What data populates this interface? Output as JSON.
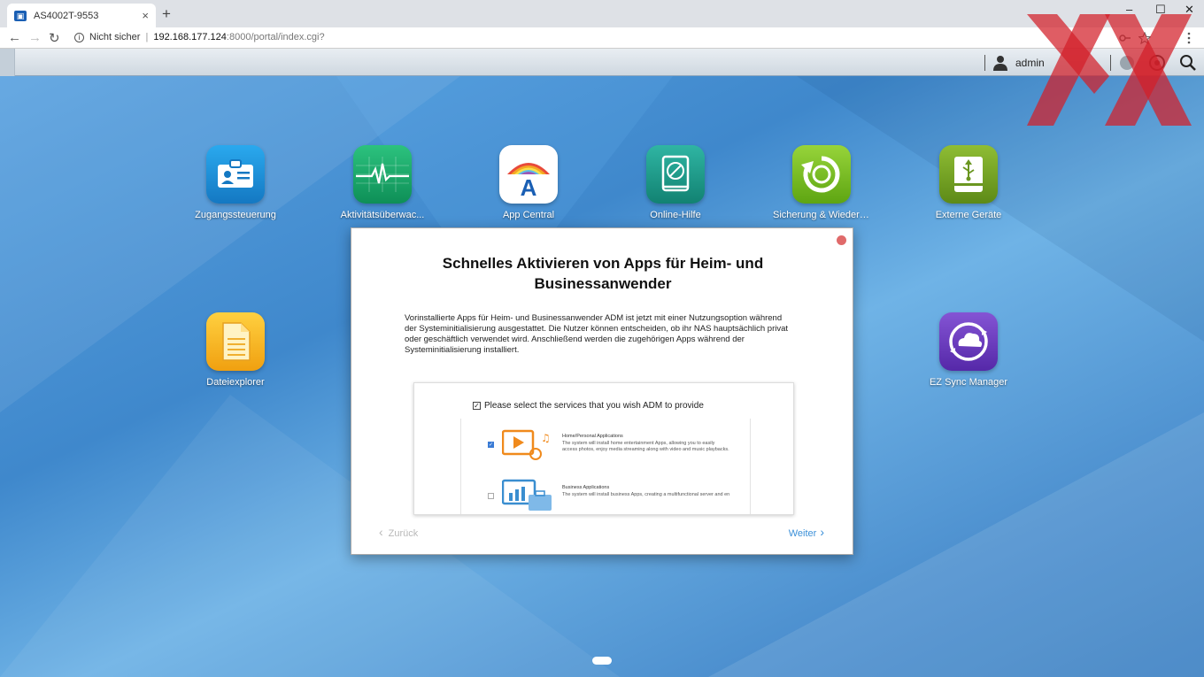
{
  "browser": {
    "tab_title": "AS4002T-9553",
    "tab_close": "×",
    "new_tab": "+",
    "security": "Nicht sicher",
    "url_host": "192.168.177.124",
    "url_path": ":8000/portal/index.cgi?",
    "win_min": "–",
    "win_max": "☐",
    "win_close": "✕",
    "back": "←",
    "forward": "→",
    "reload": "↻"
  },
  "taskbar": {
    "user": "admin"
  },
  "apps": [
    {
      "label": "Zugangssteuerung",
      "icon": "access-control-icon",
      "color": "#1b8fd6"
    },
    {
      "label": "Aktivitätsüberwac...",
      "icon": "activity-monitor-icon",
      "color": "#1aa56a"
    },
    {
      "label": "App Central",
      "icon": "app-central-icon",
      "color": "#ffffff"
    },
    {
      "label": "Online-Hilfe",
      "icon": "online-help-icon",
      "color": "#1f9c8c"
    },
    {
      "label": "Sicherung & Wiederherstellung",
      "icon": "backup-icon",
      "color": "#7cc21e"
    },
    {
      "label": "Externe Geräte",
      "icon": "external-devices-icon",
      "color": "#7ea62a"
    },
    {
      "label": "Dateiexplorer",
      "icon": "file-explorer-icon",
      "color": "#f2a81c"
    },
    {
      "label": "EZ Sync Manager",
      "icon": "ez-sync-icon",
      "color": "#6a3fb8"
    }
  ],
  "modal": {
    "title": "Schnelles Aktivieren von Apps für Heim- und Businessanwender",
    "body": "Vorinstallierte Apps für Heim- und Businessanwender ADM ist jetzt mit einer Nutzungsoption während der Systeminitialisierung ausgestattet. Die Nutzer können entscheiden, ob ihr NAS hauptsächlich privat oder geschäftlich verwendet wird. Anschließend werden die zugehörigen Apps während der Systeminitialisierung installiert.",
    "screenshot": {
      "heading": "Please select the services that you wish ADM to provide",
      "options": [
        {
          "title": "Home/Personal Applications",
          "desc": "The system will install home entertainment Apps, allowing you to easily access photos, enjoy media streaming along with video and music playbacks.",
          "checked": true
        },
        {
          "title": "Business Applications",
          "desc": "The system will install business Apps, creating a multifunctional server and en",
          "checked": false
        }
      ]
    },
    "prev": "Zurück",
    "next": "Weiter"
  }
}
